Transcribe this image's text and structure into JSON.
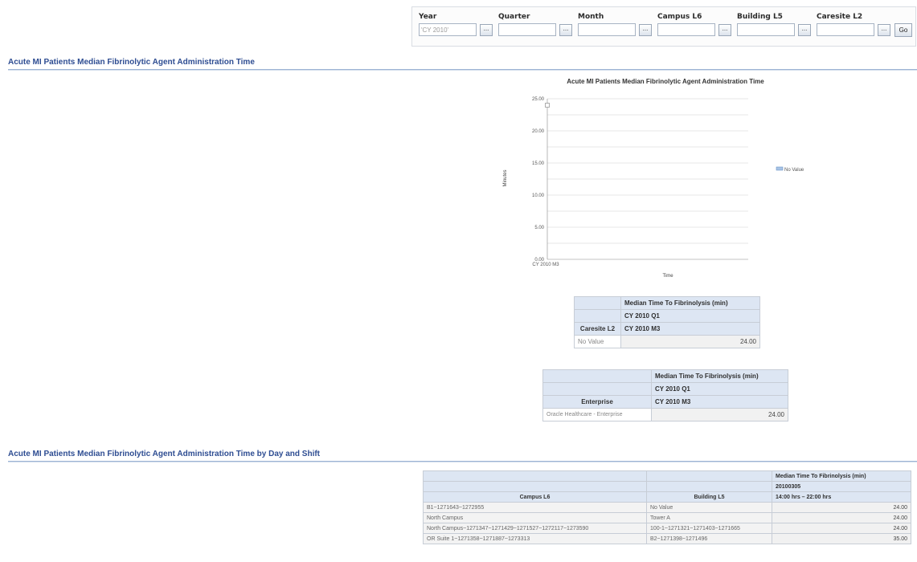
{
  "prompts": {
    "fields": [
      {
        "label": "Year",
        "value": "'CY 2010'"
      },
      {
        "label": "Quarter",
        "value": ""
      },
      {
        "label": "Month",
        "value": ""
      },
      {
        "label": "Campus L6",
        "value": ""
      },
      {
        "label": "Building L5",
        "value": ""
      },
      {
        "label": "Caresite L2",
        "value": ""
      }
    ],
    "browse_label": "...",
    "go_label": "Go"
  },
  "section1": {
    "title": "Acute MI Patients Median Fibrinolytic Agent Administration Time"
  },
  "chart_data": {
    "type": "line",
    "title": "Acute MI Patients Median Fibrinolytic Agent Administration Time",
    "xlabel": "Time",
    "ylabel": "Minutes",
    "x": [
      "CY 2010 M3"
    ],
    "yticks": [
      "0.00",
      "5.00",
      "10.00",
      "15.00",
      "20.00",
      "25.00"
    ],
    "ylim": [
      0,
      25
    ],
    "series": [
      {
        "name": "No Value",
        "values": [
          24.0
        ]
      }
    ],
    "grid": true,
    "legend": "right"
  },
  "table_caresite": {
    "measure": "Median Time To Fibrinolysis (min)",
    "quarter": "CY 2010 Q1",
    "row_header": "Caresite L2",
    "month": "CY 2010 M3",
    "rows": [
      {
        "label": "No Value",
        "value": "24.00"
      }
    ]
  },
  "table_enterprise": {
    "measure": "Median Time To Fibrinolysis (min)",
    "quarter": "CY 2010 Q1",
    "row_header": "Enterprise",
    "month": "CY 2010 M3",
    "rows": [
      {
        "label": "Oracle Healthcare - Enterprise",
        "value": "24.00"
      }
    ]
  },
  "section2": {
    "title": "Acute MI Patients Median Fibrinolytic Agent Administration Time by Day and Shift"
  },
  "table_day_shift": {
    "measure": "Median Time To Fibrinolysis (min)",
    "date": "20100305",
    "col1": "Campus L6",
    "col2": "Building L5",
    "shift": "14:00 hrs – 22:00 hrs",
    "rows": [
      {
        "campus": "B1~1271643~1272955",
        "building": "No Value",
        "value": "24.00"
      },
      {
        "campus": "North Campus",
        "building": "Tower A",
        "value": "24.00"
      },
      {
        "campus": "North Campus~1271347~1271429~1271527~1272117~1273590",
        "building": "100-1~1271321~1271403~1271665",
        "value": "24.00"
      },
      {
        "campus": "OR Suite 1~1271358~1271887~1273313",
        "building": "B2~1271398~1271496",
        "value": "35.00"
      }
    ]
  }
}
